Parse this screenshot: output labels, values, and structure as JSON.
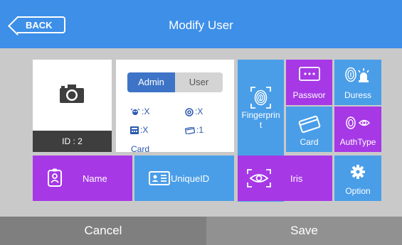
{
  "header": {
    "back_label": "BACK",
    "title": "Modify User",
    "color": "#3d8fe8"
  },
  "photo": {
    "icon": "camera-icon",
    "id_label": "ID : 2"
  },
  "user_info": {
    "role_options": [
      "Admin",
      "User"
    ],
    "role_selected": "Admin",
    "stats": {
      "face": ":X",
      "fingerprint": ":X",
      "palm": ":X",
      "card": ":1"
    },
    "card_label": "Card"
  },
  "tiles": {
    "fingerprint": "Fingerprint",
    "password": "Passwor",
    "duress": "Duress",
    "card": "Card",
    "auth_type": "AuthType",
    "name": "Name",
    "unique_id": "UniqueID",
    "iris": "Iris",
    "option": "Option"
  },
  "footer": {
    "cancel_label": "Cancel",
    "save_label": "Save"
  },
  "colors": {
    "blue": "#4a9ee8",
    "purple": "#a638e6",
    "toggle_active": "#3e74c7"
  }
}
